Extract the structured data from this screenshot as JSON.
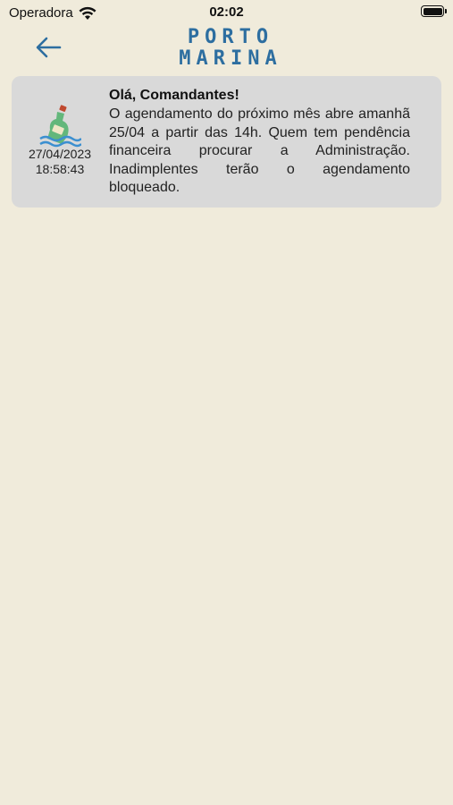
{
  "status_bar": {
    "carrier": "Operadora",
    "time": "02:02"
  },
  "header": {
    "logo_line1": "PORTO",
    "logo_line2": "MARINA",
    "accent_color": "#2d6ea0"
  },
  "messages": [
    {
      "icon": "bottle-message-icon",
      "date": "27/04/2023",
      "time": "18:58:43",
      "title": "Olá, Comandantes!",
      "body": "O agendamento do próximo mês abre amanhã 25/04 a partir das 14h. Quem tem pendência financeira procurar a Administração. Inadimplentes terão o agendamento bloqueado."
    }
  ]
}
